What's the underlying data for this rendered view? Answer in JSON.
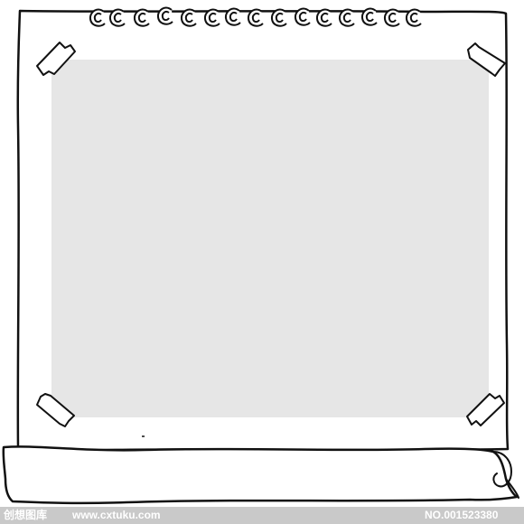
{
  "watermark": {
    "brand": "创想图库",
    "url": "www.cxtuku.com",
    "id": "NO.001523380"
  },
  "colors": {
    "line": "#111111",
    "paper": "#ffffff",
    "photo_area": "#e6e6e6",
    "watermark_bar": "#c9c9c9",
    "watermark_text": "#ffffff"
  },
  "elements": {
    "spiral_binding_icon": "spiral-binding",
    "tape_icon": "tape-strip",
    "scroll_icon": "rolled-paper"
  }
}
